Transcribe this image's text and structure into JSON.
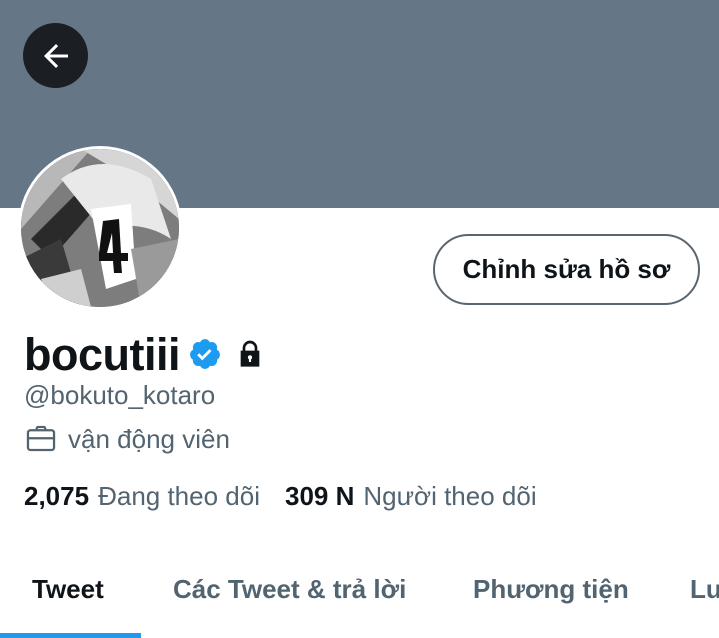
{
  "header": {
    "back_icon": "arrow-left-icon",
    "banner_color": "#657786"
  },
  "profile": {
    "avatar_icon": "profile-avatar-image",
    "edit_button_label": "Chỉnh sửa hồ sơ",
    "display_name": "bocutiii",
    "verified_icon": "verified-badge-icon",
    "verified_color": "#1d9bf0",
    "protected_icon": "lock-icon",
    "handle": "@bokuto_kotaro",
    "occupation_icon": "briefcase-icon",
    "occupation": "vận động viên"
  },
  "stats": {
    "following_count": "2,075",
    "following_label": "Đang theo dõi",
    "followers_count": "309 N",
    "followers_label": "Người theo dõi"
  },
  "tabs": [
    {
      "label": "Tweet",
      "active": true
    },
    {
      "label": "Các Tweet & trả lời",
      "active": false
    },
    {
      "label": "Phương tiện",
      "active": false
    },
    {
      "label": "Lu",
      "active": false
    }
  ],
  "colors": {
    "accent": "#1d9bf0",
    "secondary_text": "#536471",
    "primary_text": "#0f1419"
  }
}
